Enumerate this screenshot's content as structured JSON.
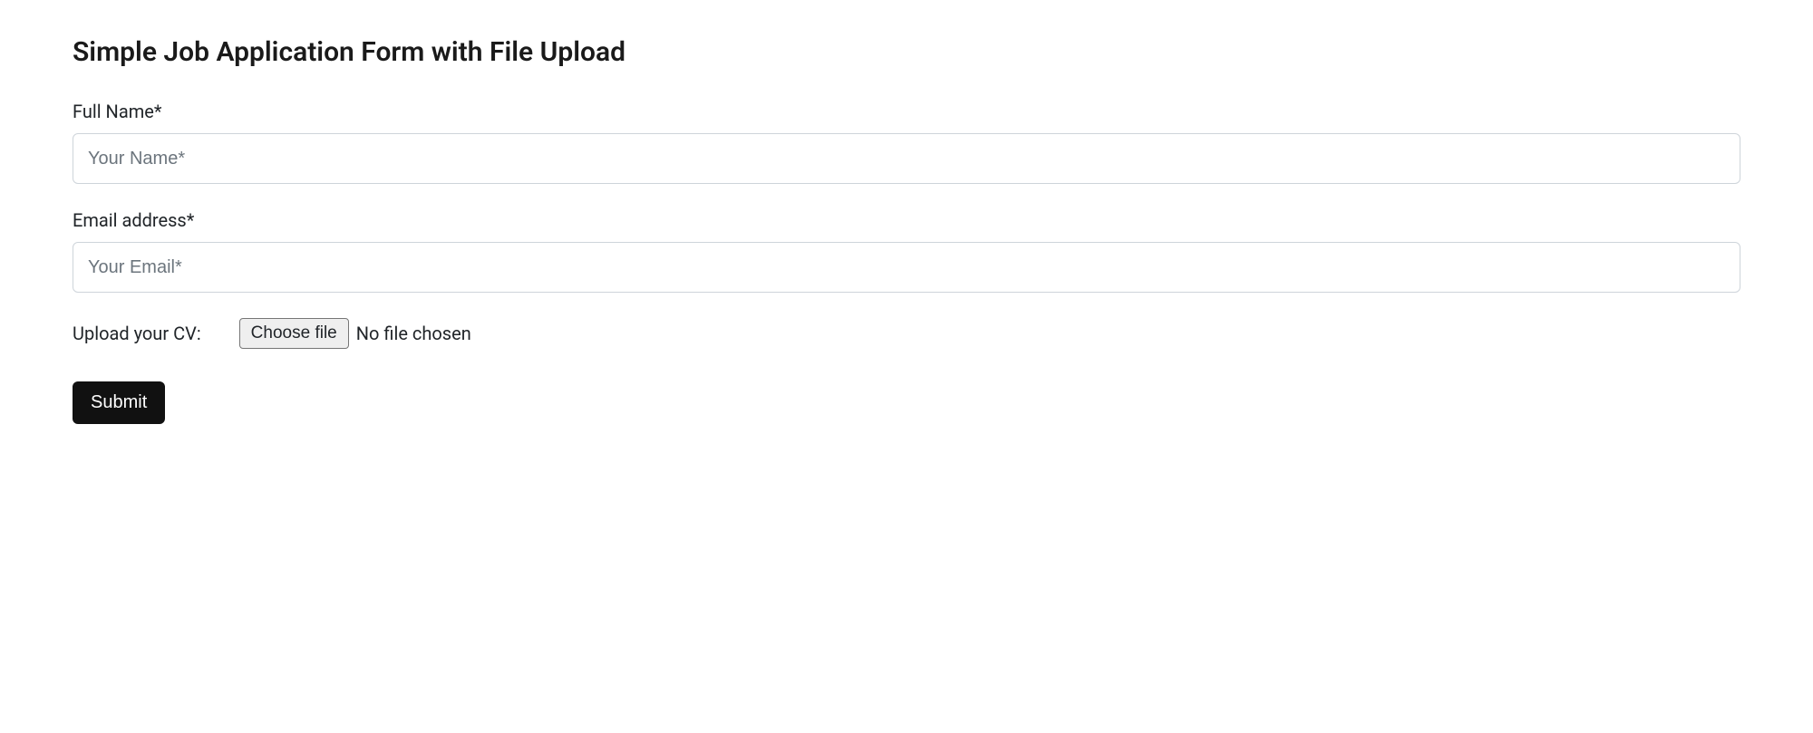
{
  "title": "Simple Job Application Form with File Upload",
  "fields": {
    "fullName": {
      "label": "Full Name*",
      "placeholder": "Your Name*",
      "value": ""
    },
    "email": {
      "label": "Email address*",
      "placeholder": "Your Email*",
      "value": ""
    },
    "cv": {
      "label": "Upload your CV:",
      "button": "Choose file",
      "status": "No file chosen"
    }
  },
  "submit": {
    "label": "Submit"
  }
}
